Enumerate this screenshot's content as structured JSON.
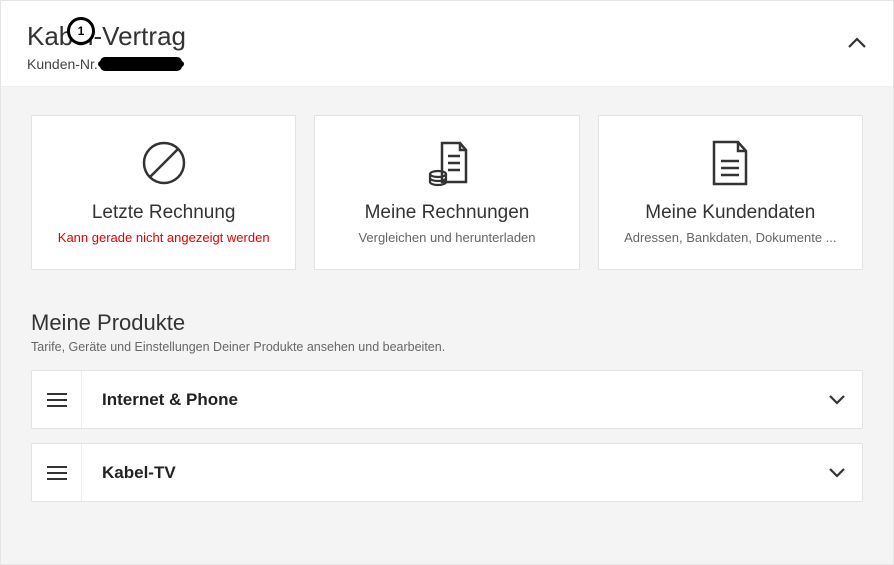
{
  "header": {
    "title": "Kabel-Vertrag",
    "customer_label": "Kunden-Nr.",
    "badge_number": "1"
  },
  "cards": [
    {
      "icon": "prohibit-icon",
      "title": "Letzte Rechnung",
      "subtitle": "Kann gerade nicht angezeigt werden",
      "error": true
    },
    {
      "icon": "invoices-icon",
      "title": "Meine Rechnungen",
      "subtitle": "Vergleichen und herunterladen",
      "error": false
    },
    {
      "icon": "document-icon",
      "title": "Meine Kundendaten",
      "subtitle": "Adressen, Bankdaten, Dokumente ...",
      "error": false
    }
  ],
  "products_section": {
    "title": "Meine Produkte",
    "subtitle": "Tarife, Geräte und Einstellungen Deiner Produkte ansehen und bearbeiten."
  },
  "products": [
    {
      "label": "Internet & Phone"
    },
    {
      "label": "Kabel-TV"
    }
  ]
}
